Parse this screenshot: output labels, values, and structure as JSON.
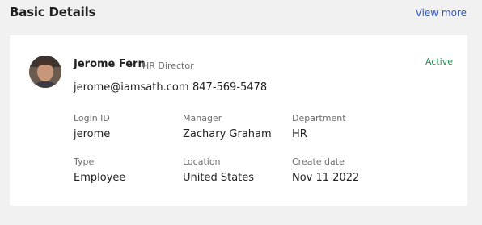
{
  "section": {
    "title": "Basic Details",
    "view_more": "View more"
  },
  "profile": {
    "name": "Jerome Fern",
    "role": "HR Director",
    "status": "Active",
    "email": "jerome@iamsath.com",
    "phone": "847-569-5478"
  },
  "fields": [
    {
      "label": "Login ID",
      "value": "jerome"
    },
    {
      "label": "Manager",
      "value": "Zachary Graham"
    },
    {
      "label": "Department",
      "value": "HR"
    },
    {
      "label": "Type",
      "value": "Employee"
    },
    {
      "label": "Location",
      "value": "United States"
    },
    {
      "label": "Create date",
      "value": "Nov 11 2022"
    }
  ],
  "colors": {
    "link": "#2b54c9",
    "status_active": "#2e8b57",
    "background": "#f1f1f1",
    "card": "#ffffff"
  },
  "icons": {
    "avatar": "user-photo"
  }
}
